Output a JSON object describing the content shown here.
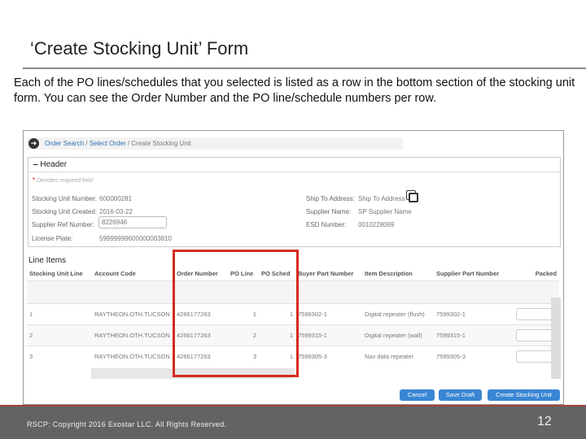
{
  "slide": {
    "title": "‘Create Stocking Unit’ Form",
    "description": "Each of the PO lines/schedules that you selected is listed as a row in the bottom section of the stocking unit form.  You can see the Order Number and the PO line/schedule numbers per row."
  },
  "breadcrumb": {
    "items": [
      "Order Search",
      "Select Order"
    ],
    "current": "Create Stocking Unit",
    "sep": " / "
  },
  "header": {
    "title": "Header",
    "collapse": "‒",
    "required_note": "Denotes required field",
    "fields": {
      "stocking_unit_number": {
        "label": "Stocking Unit Number:",
        "value": "600000281"
      },
      "created": {
        "label": "Stocking Unit Created:",
        "value": "2016-03-22"
      },
      "supplier_ref": {
        "label": "Supplier Ref Number:",
        "value": "8226946"
      },
      "license_plate": {
        "label": "License Plate:",
        "value": "59999999600000003810"
      },
      "ship_to": {
        "label": "Ship To Address:",
        "value": "Ship To Address"
      },
      "supplier_name": {
        "label": "Supplier Name:",
        "value": "SP Supplier Name"
      },
      "esd": {
        "label": "ESD Number:",
        "value": "0010228069"
      }
    }
  },
  "line_items": {
    "title": "Line Items",
    "columns": [
      "Stocking Unit Line",
      "Account Code",
      "Order Number",
      "PO Line",
      "PO Sched",
      "Buyer Part Number",
      "Item Description",
      "Supplier Part Number",
      "Packed"
    ],
    "rows": [
      [
        "1",
        "RAYTHEON.OTH.TUCSON",
        "4266177263",
        "1",
        "1",
        "7599302-1",
        "Digital repeater (flush)",
        "7599302-1"
      ],
      [
        "2",
        "RAYTHEON.OTH.TUCSON",
        "4266177263",
        "2",
        "1",
        "7599315-1",
        "Digital repeater (wall)",
        "7599315-1"
      ],
      [
        "3",
        "RAYTHEON.OTH.TUCSON",
        "4266177263",
        "3",
        "1",
        "7599305-3",
        "Nav data repeater",
        "7599305-3"
      ]
    ]
  },
  "buttons": {
    "cancel": "Cancel",
    "save_draft": "Save Draft",
    "create": "Create Stocking Unit"
  },
  "footer": {
    "copyright": "RSCP:  Copyright 2016 Exostar LLC. All Rights Reserved.",
    "page": "12"
  },
  "colors": {
    "highlight": "#d42a20",
    "button": "#3a86d4",
    "footer": "#636363"
  }
}
